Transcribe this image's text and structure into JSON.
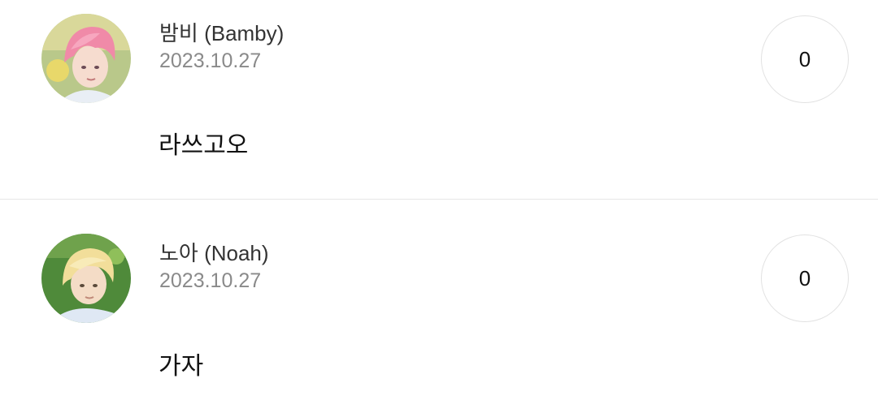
{
  "posts": [
    {
      "author": "밤비 (Bamby)",
      "date": "2023.10.27",
      "text": "라쓰고오",
      "count": "0",
      "avatar_icon": "profile-photo-pink-hair"
    },
    {
      "author": "노아 (Noah)",
      "date": "2023.10.27",
      "text": "가자",
      "count": "0",
      "avatar_icon": "profile-photo-blonde-hair"
    }
  ],
  "colors": {
    "author": "#333333",
    "date": "#8a8a8a",
    "text": "#111111",
    "divider": "#e6e6e6",
    "counter_border": "#e2e2e2"
  }
}
